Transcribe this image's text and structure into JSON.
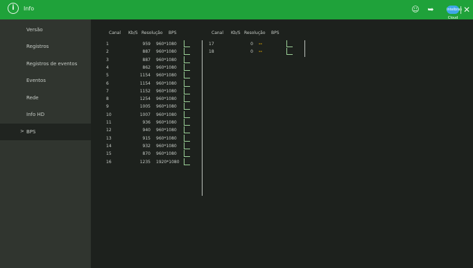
{
  "header": {
    "title": "Info"
  },
  "sidebar": {
    "items": [
      {
        "label": "Versão"
      },
      {
        "label": "Registros"
      },
      {
        "label": "Registros de eventos"
      },
      {
        "label": "Eventos"
      },
      {
        "label": "Rede"
      },
      {
        "label": "Info HD"
      },
      {
        "label": "BPS",
        "active": true,
        "arrow": ">"
      }
    ]
  },
  "table": {
    "headers": [
      "Canal",
      "Kb/S",
      "Resolução",
      "BPS"
    ],
    "left_rows": [
      {
        "canal": "1",
        "kbs": "959",
        "res": "960*1080"
      },
      {
        "canal": "2",
        "kbs": "887",
        "res": "960*1080"
      },
      {
        "canal": "3",
        "kbs": "887",
        "res": "960*1080"
      },
      {
        "canal": "4",
        "kbs": "862",
        "res": "960*1080"
      },
      {
        "canal": "5",
        "kbs": "1154",
        "res": "960*1080"
      },
      {
        "canal": "6",
        "kbs": "1154",
        "res": "960*1080"
      },
      {
        "canal": "7",
        "kbs": "1152",
        "res": "960*1080"
      },
      {
        "canal": "8",
        "kbs": "1254",
        "res": "960*1080"
      },
      {
        "canal": "9",
        "kbs": "1005",
        "res": "960*1080"
      },
      {
        "canal": "10",
        "kbs": "1007",
        "res": "960*1080"
      },
      {
        "canal": "11",
        "kbs": "936",
        "res": "960*1080"
      },
      {
        "canal": "12",
        "kbs": "940",
        "res": "960*1080"
      },
      {
        "canal": "13",
        "kbs": "915",
        "res": "960*1080"
      },
      {
        "canal": "14",
        "kbs": "932",
        "res": "960*1080"
      },
      {
        "canal": "15",
        "kbs": "870",
        "res": "960*1080"
      },
      {
        "canal": "16",
        "kbs": "1235",
        "res": "1920*1080"
      }
    ],
    "right_rows": [
      {
        "canal": "17",
        "kbs": "0",
        "res": "--"
      },
      {
        "canal": "18",
        "kbs": "0",
        "res": "--"
      }
    ]
  },
  "icons": {
    "user": "user-icon",
    "logout": "logout-icon",
    "cloud": "cloud-icon",
    "close": "close-icon",
    "info": "info-icon"
  },
  "cloud_label": "Intelbras Cloud"
}
